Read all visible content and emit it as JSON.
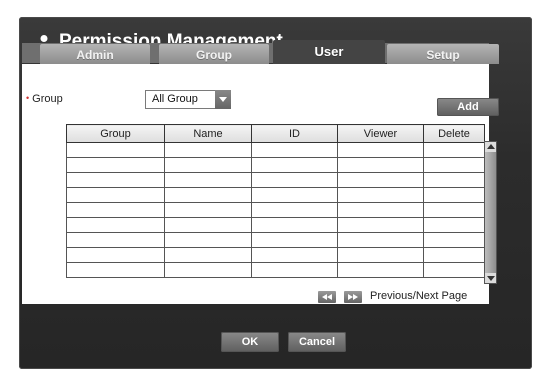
{
  "dialog": {
    "title": "Permission Management",
    "title_icon": "user-icon"
  },
  "tabs": [
    {
      "label": "Admin",
      "active": false
    },
    {
      "label": "Group",
      "active": false
    },
    {
      "label": "User",
      "active": true
    },
    {
      "label": "Setup",
      "active": false
    }
  ],
  "filter": {
    "label": "Group",
    "selected": "All Group"
  },
  "add_label": "Add",
  "table": {
    "columns": [
      "Group",
      "Name",
      "ID",
      "Viewer",
      "Delete"
    ],
    "rows": []
  },
  "pagination": {
    "prev_icon": "rewind-icon",
    "next_icon": "fast-forward-icon",
    "label": "Previous/Next Page"
  },
  "footer": {
    "ok_label": "OK",
    "cancel_label": "Cancel"
  }
}
